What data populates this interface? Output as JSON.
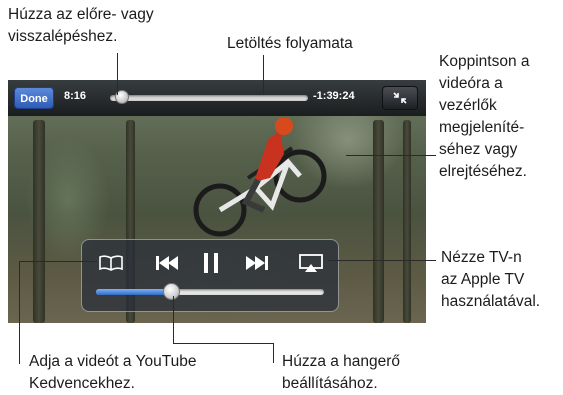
{
  "callouts": {
    "scrub": [
      "Húzza az előre- vagy",
      "visszalépéshez."
    ],
    "download": "Letöltés folyamata",
    "tap_video": [
      "Koppintson a",
      "videóra a",
      "vezérlők",
      "megjeleníté-",
      "séhez vagy",
      "elrejtéséhez."
    ],
    "tv_out": [
      "Nézze TV-n",
      "az Apple TV",
      "használatával."
    ],
    "favorites": [
      "Adja a videót a YouTube",
      "Kedvencekhez."
    ],
    "volume": [
      "Húzza a hangerő",
      "beállításához."
    ]
  },
  "player": {
    "done_label": "Done",
    "time_elapsed": "8:16",
    "time_remaining": "-1:39:24",
    "playback_progress": 0.06,
    "download_progress": 1.0,
    "volume_level": 0.33
  },
  "icons": {
    "bookmark": "book-icon",
    "previous": "previous-track-icon",
    "pause": "pause-icon",
    "next": "next-track-icon",
    "airplay": "airplay-icon",
    "fullscreen": "collapse-icon"
  },
  "colors": {
    "done_button": "#3a6ac5",
    "volume_fill": "#2f6cc9"
  }
}
